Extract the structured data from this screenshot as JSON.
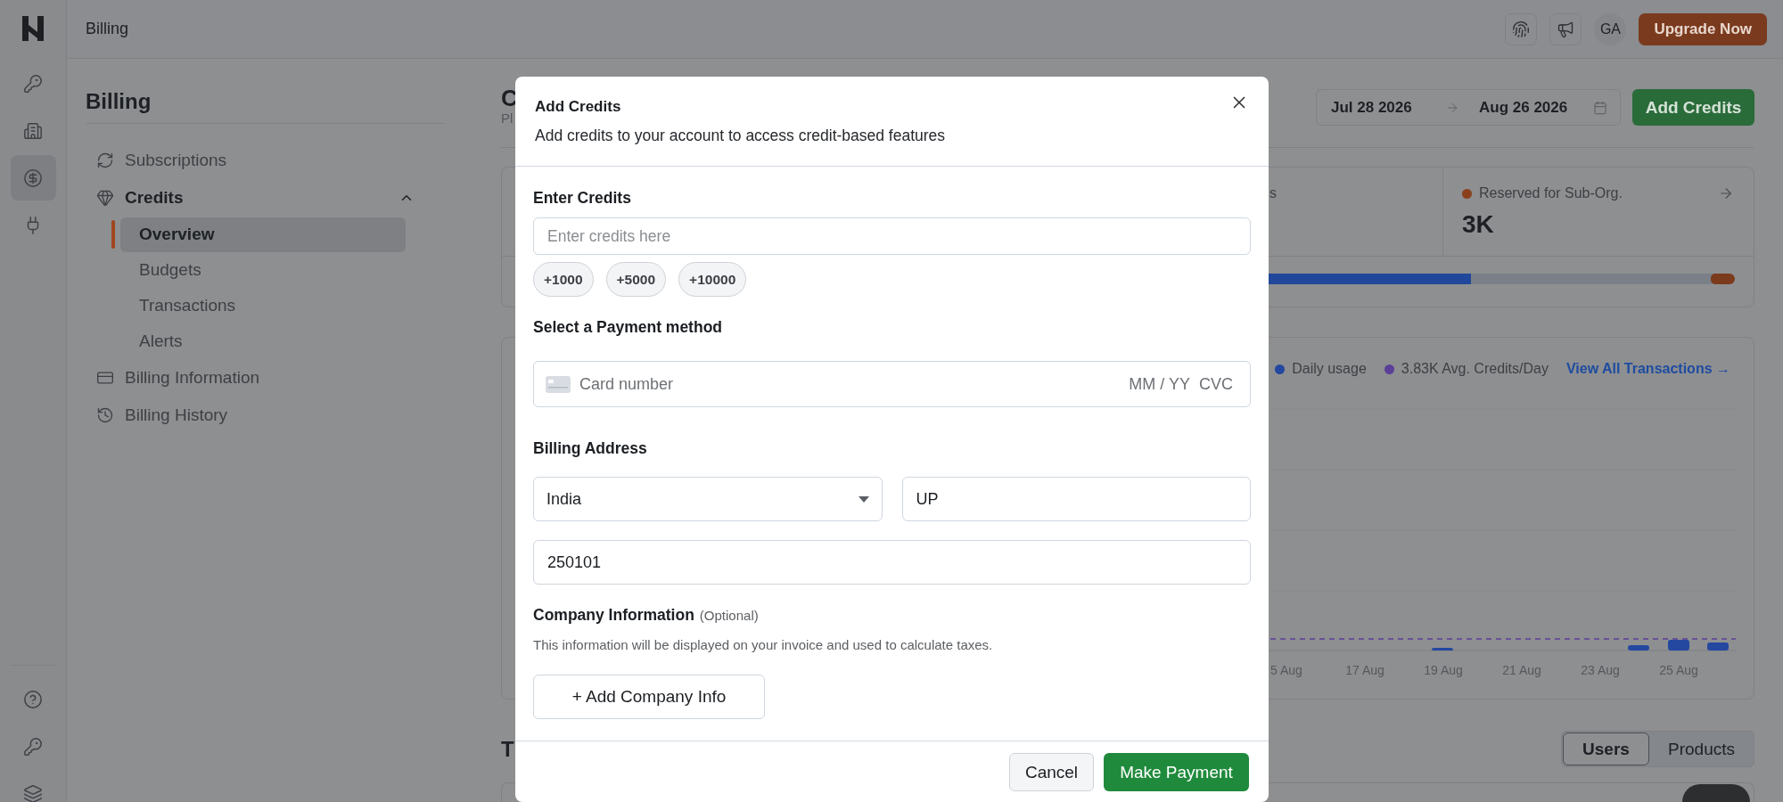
{
  "rail": {
    "items": [
      {
        "kind": "key",
        "selected": false
      },
      {
        "kind": "building",
        "selected": false
      },
      {
        "kind": "dollar",
        "selected": true
      },
      {
        "kind": "plug",
        "selected": false
      }
    ],
    "bottom": [
      {
        "kind": "help"
      },
      {
        "kind": "key"
      },
      {
        "kind": "layers"
      }
    ]
  },
  "topbar": {
    "title": "Billing",
    "avatar": "GA",
    "upgrade": "Upgrade Now"
  },
  "nav": {
    "title": "Billing",
    "items": [
      {
        "label": "Subscriptions",
        "kind": "sync"
      },
      {
        "label": "Credits",
        "kind": "gem",
        "expanded": true,
        "children": [
          {
            "label": "Overview",
            "selected": true
          },
          {
            "label": "Budgets",
            "selected": false
          },
          {
            "label": "Transactions",
            "selected": false
          },
          {
            "label": "Alerts",
            "selected": false
          }
        ]
      },
      {
        "label": "Billing Information",
        "kind": "card"
      },
      {
        "label": "Billing History",
        "kind": "history"
      }
    ]
  },
  "main": {
    "title": "C",
    "subtitle": "Pl",
    "date_from": "Jul 28 2026",
    "date_to": "Aug 26 2026",
    "add_button": "Add Credits",
    "stats": [
      {
        "label": "s"
      },
      {
        "label": "Reserved for Sub-Org.",
        "value": "3K",
        "color": "#8a3f1d"
      }
    ],
    "usage_bar": [
      {
        "color": "#21479a",
        "level": 0.78
      },
      {
        "color": "#7b3a1b",
        "level": 0.02
      }
    ],
    "legend": [
      {
        "label": "Daily usage",
        "color": "#2448a0"
      },
      {
        "label": "3.83K Avg. Credits/Day",
        "color": "#5a3f98"
      }
    ],
    "link": "View All Transactions →",
    "chart": {
      "x_labels": [
        "5 Aug",
        "17 Aug",
        "19 Aug",
        "21 Aug",
        "23 Aug",
        "25 Aug"
      ]
    },
    "section_title": "T",
    "toggle": [
      {
        "label": "Users",
        "selected": true
      },
      {
        "label": "Products",
        "selected": false
      }
    ]
  },
  "modal": {
    "title": "Add Credits",
    "subtitle": "Add credits to your account to access credit-based features",
    "credits_label": "Enter Credits",
    "credits_placeholder": "Enter credits here",
    "chips": [
      "+1000",
      "+5000",
      "+10000"
    ],
    "payment_label": "Select a Payment method",
    "card": {
      "placeholder": "Card number",
      "expiry": "MM / YY",
      "cvc": "CVC"
    },
    "address_label": "Billing Address",
    "country": "India",
    "state": "UP",
    "zip": "250101",
    "company_label": "Company Information",
    "company_optional": "(Optional)",
    "company_note": "This information will be displayed on your invoice and used to calculate taxes.",
    "company_button": "+ Add Company Info",
    "cancel": "Cancel",
    "submit": "Make Payment"
  }
}
